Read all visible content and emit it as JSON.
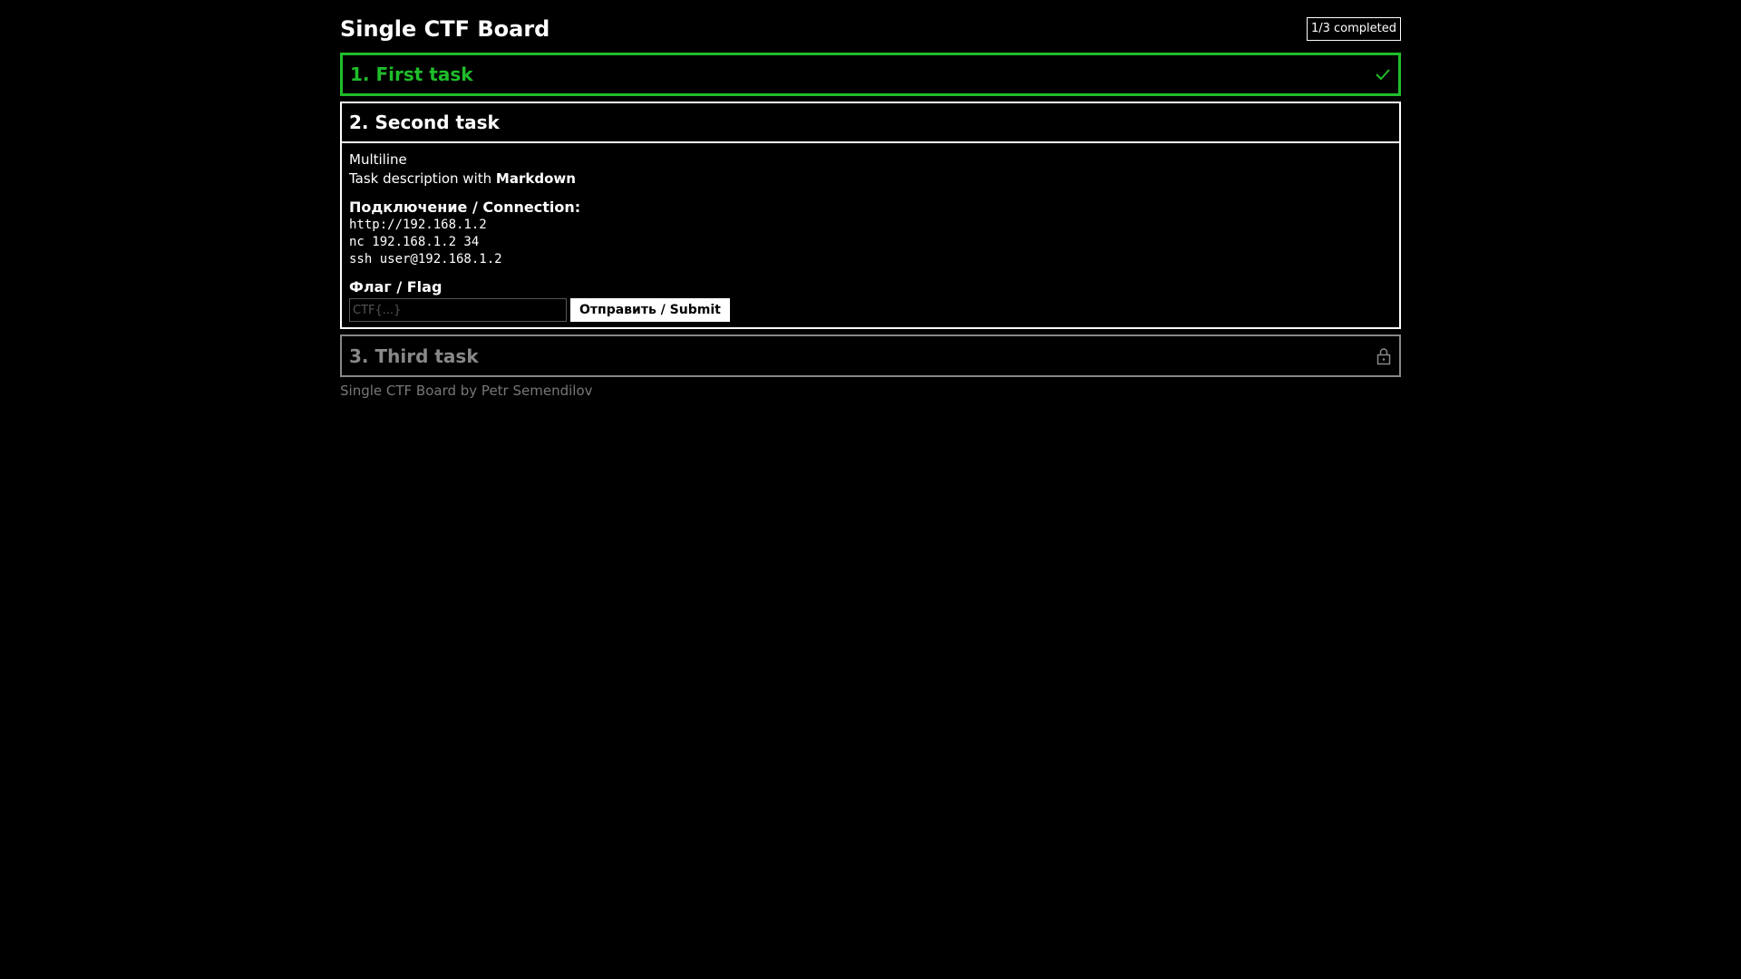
{
  "app": {
    "title": "Single CTF Board",
    "progress": "1/3 completed",
    "accent_color": "#1fbd2a"
  },
  "tasks": [
    {
      "title": "1. First task",
      "status": "completed",
      "icon": "check-icon"
    },
    {
      "title": "2. Second task",
      "status": "open",
      "description": {
        "line1": "Multiline",
        "line2_prefix": "Task description with ",
        "line2_bold": "Markdown"
      },
      "connection_heading": "Подключение / Connection:",
      "connections": [
        "http://192.168.1.2",
        "nc 192.168.1.2 34",
        "ssh user@192.168.1.2"
      ],
      "flag_heading": "Флаг / Flag",
      "flag_placeholder": "CTF{...}",
      "submit_label": "Отправить / Submit"
    },
    {
      "title": "3. Third task",
      "status": "locked",
      "icon": "lock-icon"
    }
  ],
  "footer": "Single CTF Board by Petr Semendilov"
}
